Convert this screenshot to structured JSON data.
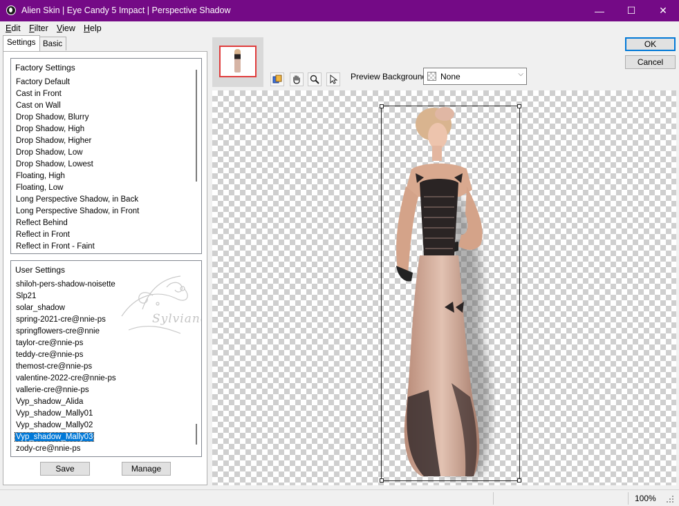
{
  "window": {
    "title": "Alien Skin | Eye Candy 5 Impact | Perspective Shadow",
    "minimize_glyph": "—",
    "maximize_glyph": "☐",
    "close_glyph": "✕"
  },
  "menu": [
    "Edit",
    "Filter",
    "View",
    "Help"
  ],
  "tabs": [
    {
      "label": "Settings",
      "active": true
    },
    {
      "label": "Basic",
      "active": false
    }
  ],
  "factory_settings": {
    "header": "Factory Settings",
    "items": [
      "Factory Default",
      "Cast in Front",
      "Cast on Wall",
      "Drop Shadow, Blurry",
      "Drop Shadow, High",
      "Drop Shadow, Higher",
      "Drop Shadow, Low",
      "Drop Shadow, Lowest",
      "Floating, High",
      "Floating, Low",
      "Long Perspective Shadow, in Back",
      "Long Perspective Shadow, in Front",
      "Reflect Behind",
      "Reflect in Front",
      "Reflect in Front - Faint"
    ]
  },
  "user_settings": {
    "header": "User Settings",
    "items": [
      "shiloh-pers-shadow-noisette",
      "Slp21",
      "solar_shadow",
      "spring-2021-cre@nnie-ps",
      "springflowers-cre@nnie",
      "taylor-cre@nnie-ps",
      "teddy-cre@nnie-ps",
      "themost-cre@nnie-ps",
      "valentine-2022-cre@nnie-ps",
      "vallerie-cre@nnie-ps",
      "Vyp_shadow_Alida",
      "Vyp_shadow_Mally01",
      "Vyp_shadow_Mally02",
      "Vyp_shadow_Mally03",
      "zody-cre@nnie-ps"
    ],
    "selected_index": 13
  },
  "watermark": "Sylviane",
  "buttons": {
    "save": "Save",
    "manage": "Manage",
    "ok": "OK",
    "cancel": "Cancel"
  },
  "toolbar": {
    "icons": [
      "preview-toggle-icon",
      "hand-icon",
      "zoom-icon",
      "arrow-icon"
    ],
    "preview_background_label": "Preview Background:",
    "preview_background_value": "None"
  },
  "status": {
    "zoom": "100%"
  },
  "colors": {
    "titlebar": "#740a86",
    "selection": "#0078d7",
    "navigator_frame": "#e03b3b"
  }
}
